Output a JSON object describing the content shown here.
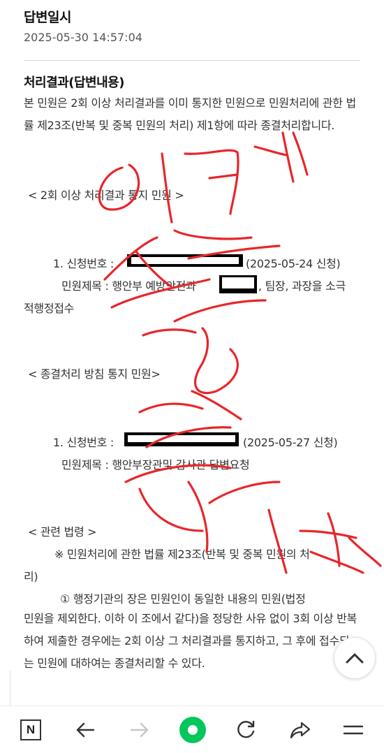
{
  "answer_date": {
    "label": "답변일시",
    "value": "2025-05-30 14:57:04"
  },
  "result": {
    "label": "처리결과(답변내용)",
    "intro": "본 민원은 2회 이상 처리결과를 이미 통지한 민원으로 민원처리에 관한 법률 제23조(반복 및 중복 민원의 처리) 제1항에 따라 종결처리합니다.",
    "group1_heading": "< 2회 이상 처리결과 통지 민원 >",
    "group1_item_no_label": "1. 신청번호 :",
    "group1_item_date": "(2025-05-24 신청)",
    "group1_title_prefix": "민원제목 : 행안부 예방안전과",
    "group1_title_suffix": ", 팀장, 과장을 소극",
    "group1_title_cont": "적행정접수",
    "group2_heading": "< 종결처리 방침 통지 민원>",
    "group2_item_no_label": "1. 신청번호 :",
    "group2_item_date": "(2025-05-27 신청)",
    "group2_title": "민원제목 : 행안부장관및 감사관 답변요청",
    "law_heading": "< 관련 법령 >",
    "law_ref_line1": "※ 민원처리에 관한 법률 제23조(반복 및 중복 민원의 처",
    "law_ref_line2": "리)",
    "law_clause_line1": "① 행정기관의 장은 민원인이 동일한 내용의 민원(법정",
    "law_clause_rest": "민원을 제외한다. 이하 이 조에서 같다)을 정당한 사유 없이 3회 이상 반복하여 제출한 경우에는 2회 이상 그 처리결과를 통지하고, 그 후에 접수되는 민원에 대하여는 종결처리할 수 있다."
  },
  "nav": {
    "home": "N",
    "icons": [
      "naver-home-icon",
      "back-arrow-icon",
      "forward-arrow-icon",
      "green-dot-icon",
      "reload-icon",
      "share-icon",
      "menu-icon"
    ]
  },
  "colors": {
    "scribble": "#e8262a",
    "green": "#03c75a"
  }
}
